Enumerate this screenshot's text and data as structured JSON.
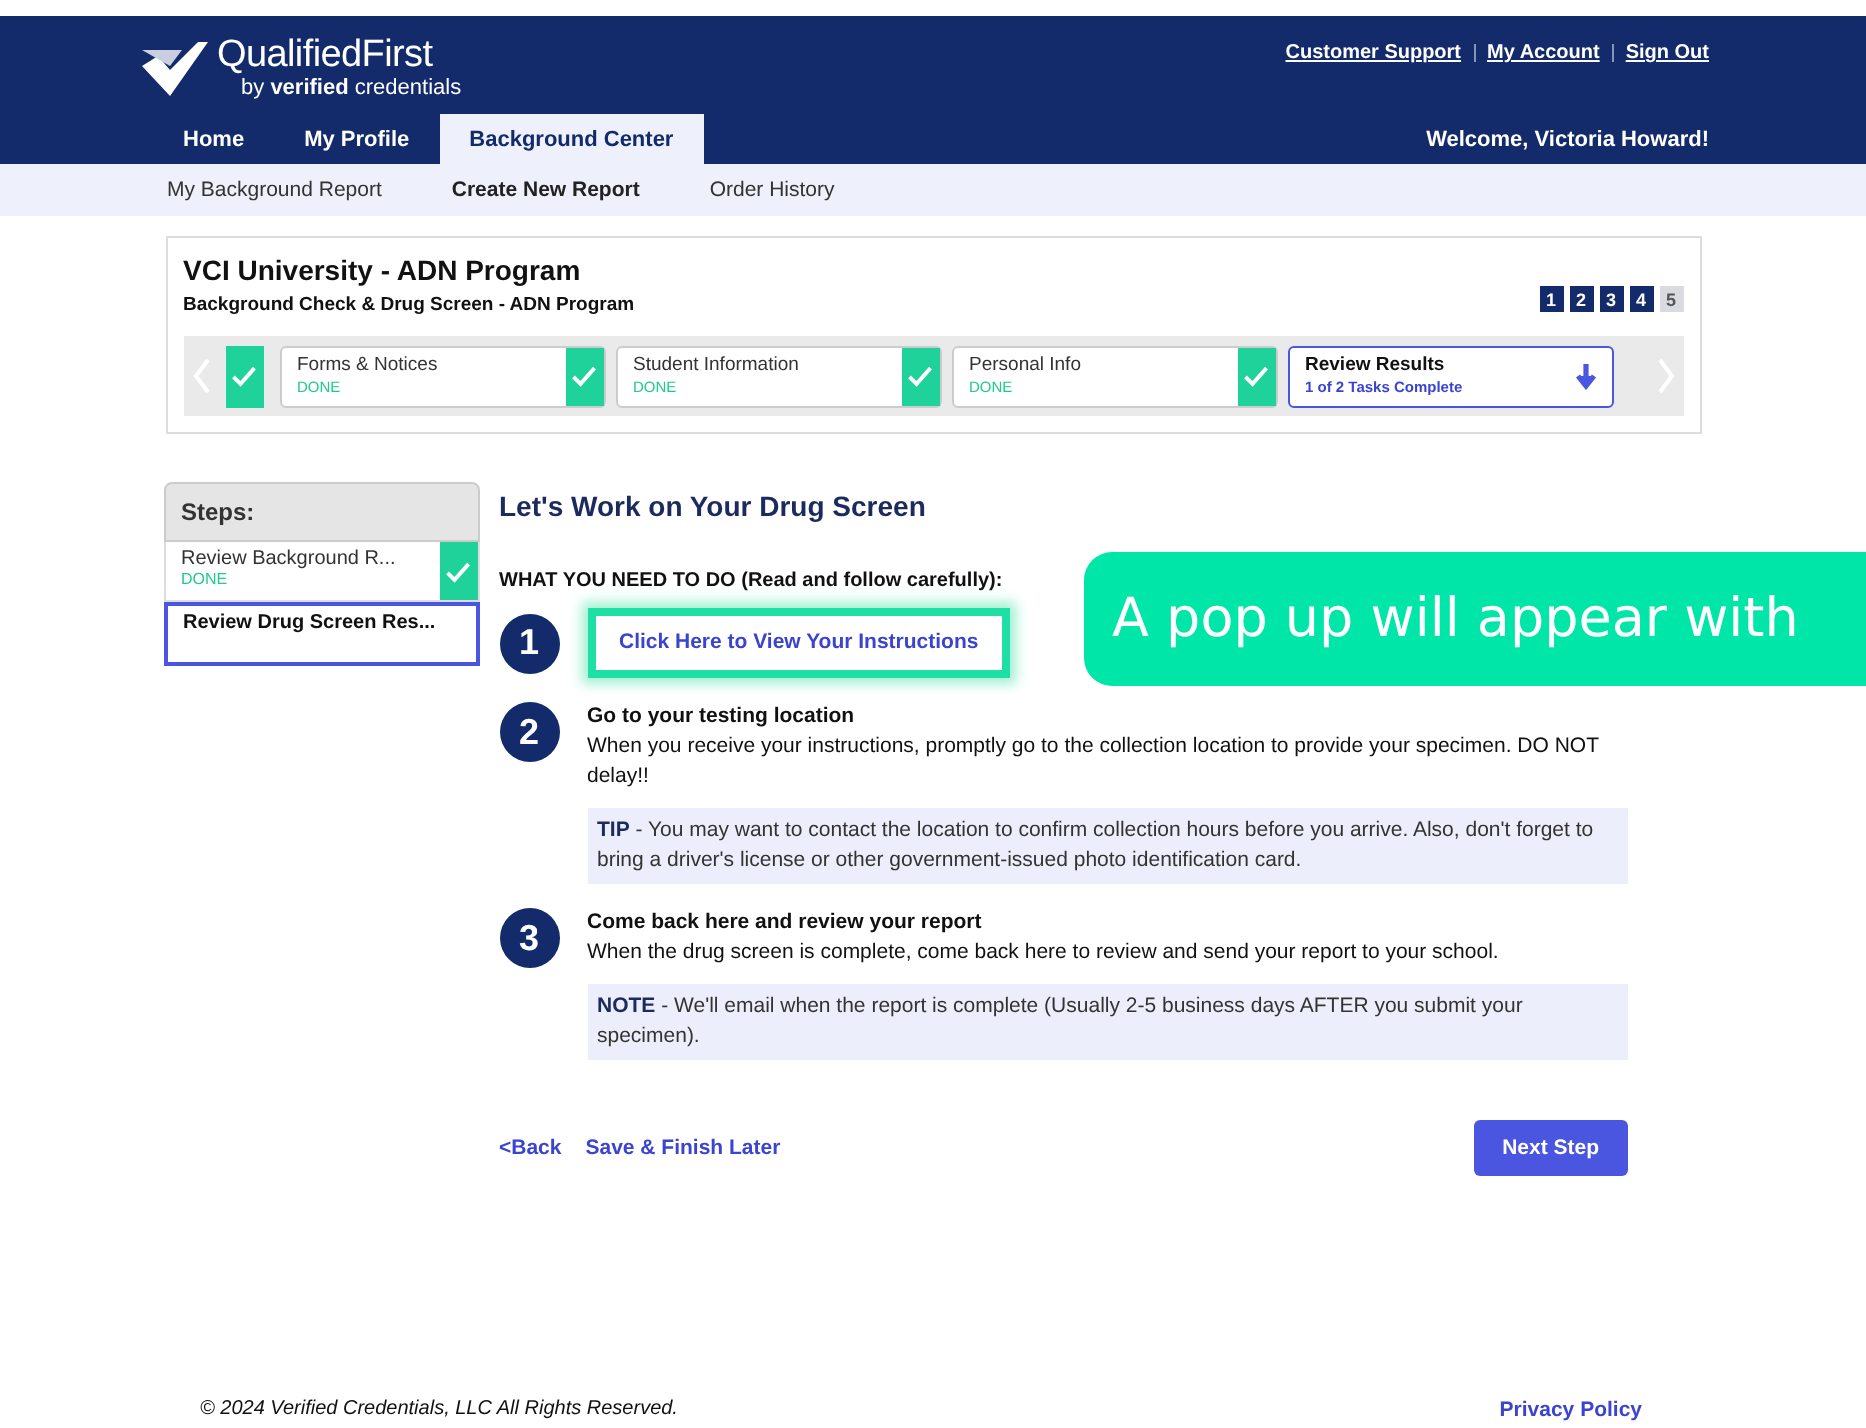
{
  "header": {
    "brand": "QualifiedFirst",
    "tagline": "by **verified** credentials",
    "links": [
      "Customer Support",
      "My Account",
      "Sign Out"
    ],
    "tabs": [
      {
        "label": "Home",
        "selected": false
      },
      {
        "label": "My Profile",
        "selected": false
      },
      {
        "label": "Background Center",
        "selected": true
      }
    ],
    "welcome": "Welcome,  Victoria Howard!"
  },
  "subnav": [
    {
      "label": "My Background Report",
      "selected": false
    },
    {
      "label": "Create New Report",
      "selected": true
    },
    {
      "label": "Order History",
      "selected": false
    }
  ],
  "program": {
    "title": "VCI University - ADN Program",
    "subtitle": "Background Check & Drug Screen - ADN Program",
    "pages": [
      {
        "label": "1",
        "done": true
      },
      {
        "label": "2",
        "done": true
      },
      {
        "label": "3",
        "done": true
      },
      {
        "label": "4",
        "done": true
      },
      {
        "label": "5",
        "done": false
      }
    ],
    "cards": [
      {
        "done": true
      },
      {
        "label": "Forms & Notices",
        "status": "DONE",
        "done": true
      },
      {
        "label": "Student Information",
        "status": "DONE",
        "done": true
      },
      {
        "label": "Personal Info",
        "status": "DONE",
        "done": true
      },
      {
        "label": "Review Results",
        "status": "1 of 2 Tasks Complete",
        "done": false
      }
    ]
  },
  "steps": {
    "title": "Steps:",
    "items": [
      {
        "label": "Review Background R...",
        "status": "DONE",
        "done": true,
        "selected": false
      },
      {
        "label": "Review Drug Screen Res...",
        "done": false,
        "selected": true
      }
    ]
  },
  "main": {
    "heading": "Let's Work on Your Drug Screen",
    "intro": "WHAT YOU NEED TO DO (Read and follow carefully):",
    "tasks": [
      {
        "number": "1",
        "link": "Click Here to View Your Instructions",
        "highlighted": true
      },
      {
        "number": "2",
        "title": "Go to your testing location",
        "text": "When you receive your instructions, promptly go to the collection location to provide your specimen. DO NOT delay!!",
        "note": "**TIP** - You may want to contact the location to confirm collection hours before you arrive. Also, don't forget to bring a driver's license or other government-issued photo identification card."
      },
      {
        "number": "3",
        "title": "Come back here and review your report",
        "text": "When the drug screen is complete, come back here to review and send your report to your school.",
        "note": "**NOTE** - We'll email when the report is complete (Usually 2-5 business days AFTER you submit your specimen)."
      }
    ],
    "back": "<Back",
    "save": "Save & Finish Later",
    "next": "Next Step"
  },
  "callout": "A pop up will appear with",
  "footer": {
    "copyright": "© 2024 Verified Credentials, LLC All Rights Reserved.",
    "privacy": "Privacy Policy"
  }
}
